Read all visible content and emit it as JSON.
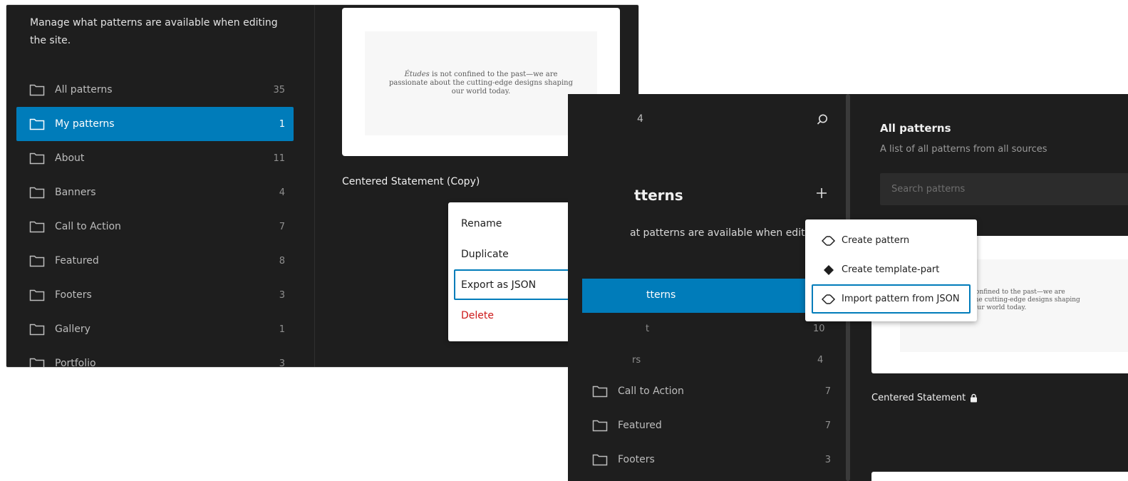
{
  "left_panel": {
    "description": "Manage what patterns are available when editing the site.",
    "categories": [
      {
        "label": "All patterns",
        "count": "35"
      },
      {
        "label": "My patterns",
        "count": "1"
      },
      {
        "label": "About",
        "count": "11"
      },
      {
        "label": "Banners",
        "count": "4"
      },
      {
        "label": "Call to Action",
        "count": "7"
      },
      {
        "label": "Featured",
        "count": "8"
      },
      {
        "label": "Footers",
        "count": "3"
      },
      {
        "label": "Gallery",
        "count": "1"
      },
      {
        "label": "Portfolio",
        "count": "3"
      }
    ],
    "preview_text_emph": "Études",
    "preview_text_rest": " is not confined to the past—we are passionate about the cutting-edge designs shaping our world today.",
    "pattern_title": "Centered Statement (Copy)",
    "actions_menu": [
      {
        "label": "Rename"
      },
      {
        "label": "Duplicate"
      },
      {
        "label": "Export as JSON"
      },
      {
        "label": "Delete"
      }
    ]
  },
  "right_panel": {
    "frag_top": "4",
    "heading_frag": "tterns",
    "description_frag": "at patterns are available when editi",
    "active_item_frag": "tterns",
    "frag_rows": [
      {
        "label": "t",
        "count": "10"
      },
      {
        "label": "rs",
        "count": "4"
      }
    ],
    "categories": [
      {
        "label": "Call to Action",
        "count": "7"
      },
      {
        "label": "Featured",
        "count": "7"
      },
      {
        "label": "Footers",
        "count": "3"
      }
    ],
    "content_title": "All patterns",
    "content_subtitle": "A list of all patterns from all sources",
    "search_placeholder": "Search patterns",
    "preview_lines": [
      "confined to the past—we are",
      "the cutting-edge designs shaping",
      "our world today."
    ],
    "pattern_title": "Centered Statement",
    "add_menu": [
      {
        "label": "Create pattern",
        "icon": "pattern-icon"
      },
      {
        "label": "Create template-part",
        "icon": "template-part-icon"
      },
      {
        "label": "Import pattern from JSON",
        "icon": "pattern-icon"
      }
    ]
  },
  "colors": {
    "accent": "#007cba",
    "background": "#1e1e1e",
    "danger": "#cc1818"
  }
}
